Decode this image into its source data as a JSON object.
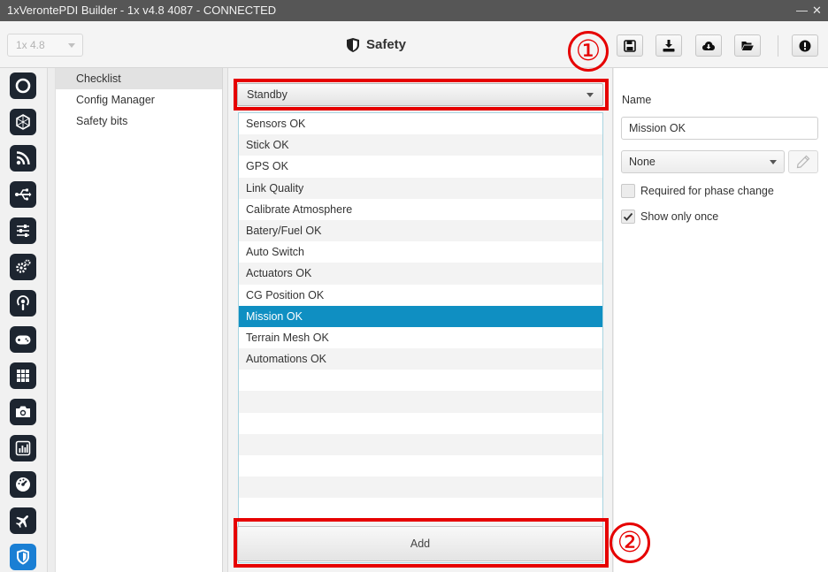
{
  "window": {
    "title": "1xVeronte​PDI Builder - 1x v4.8 4087 - CONNECTED",
    "minimize": "—",
    "close": "✕"
  },
  "toolbar": {
    "version": "1x 4.8",
    "page_title": "Safety",
    "buttons": [
      "save-icon",
      "download-icon",
      "cloud-download-icon",
      "folder-open-icon",
      "info-icon"
    ]
  },
  "iconbar": {
    "items": [
      "power-icon",
      "hexagon-icon",
      "rss-icon",
      "usb-icon",
      "sliders-icon",
      "gears-icon",
      "podcast-icon",
      "gamepad-icon",
      "grid-icon",
      "camera-icon",
      "chart-icon",
      "gauge-icon",
      "plane-icon",
      "shield-icon"
    ],
    "active": "shield-icon"
  },
  "subnav": {
    "items": [
      "Checklist",
      "Config Manager",
      "Safety bits"
    ],
    "selected": "Checklist"
  },
  "checklist": {
    "phase": "Standby",
    "items": [
      "Sensors OK",
      "Stick OK",
      "GPS OK",
      "Link Quality",
      "Calibrate Atmosphere",
      "Batery/Fuel OK",
      "Auto Switch",
      "Actuators OK",
      "CG Position OK",
      "Mission OK",
      "Terrain Mesh OK",
      "Automations OK"
    ],
    "selected": "Mission OK",
    "add_label": "Add"
  },
  "detail": {
    "name_label": "Name",
    "name_value": "Mission OK",
    "condition": "None",
    "required_label": "Required for phase change",
    "required_checked": false,
    "show_once_label": "Show only once",
    "show_once_checked": true
  },
  "annotations": {
    "one": "①",
    "two": "②"
  }
}
